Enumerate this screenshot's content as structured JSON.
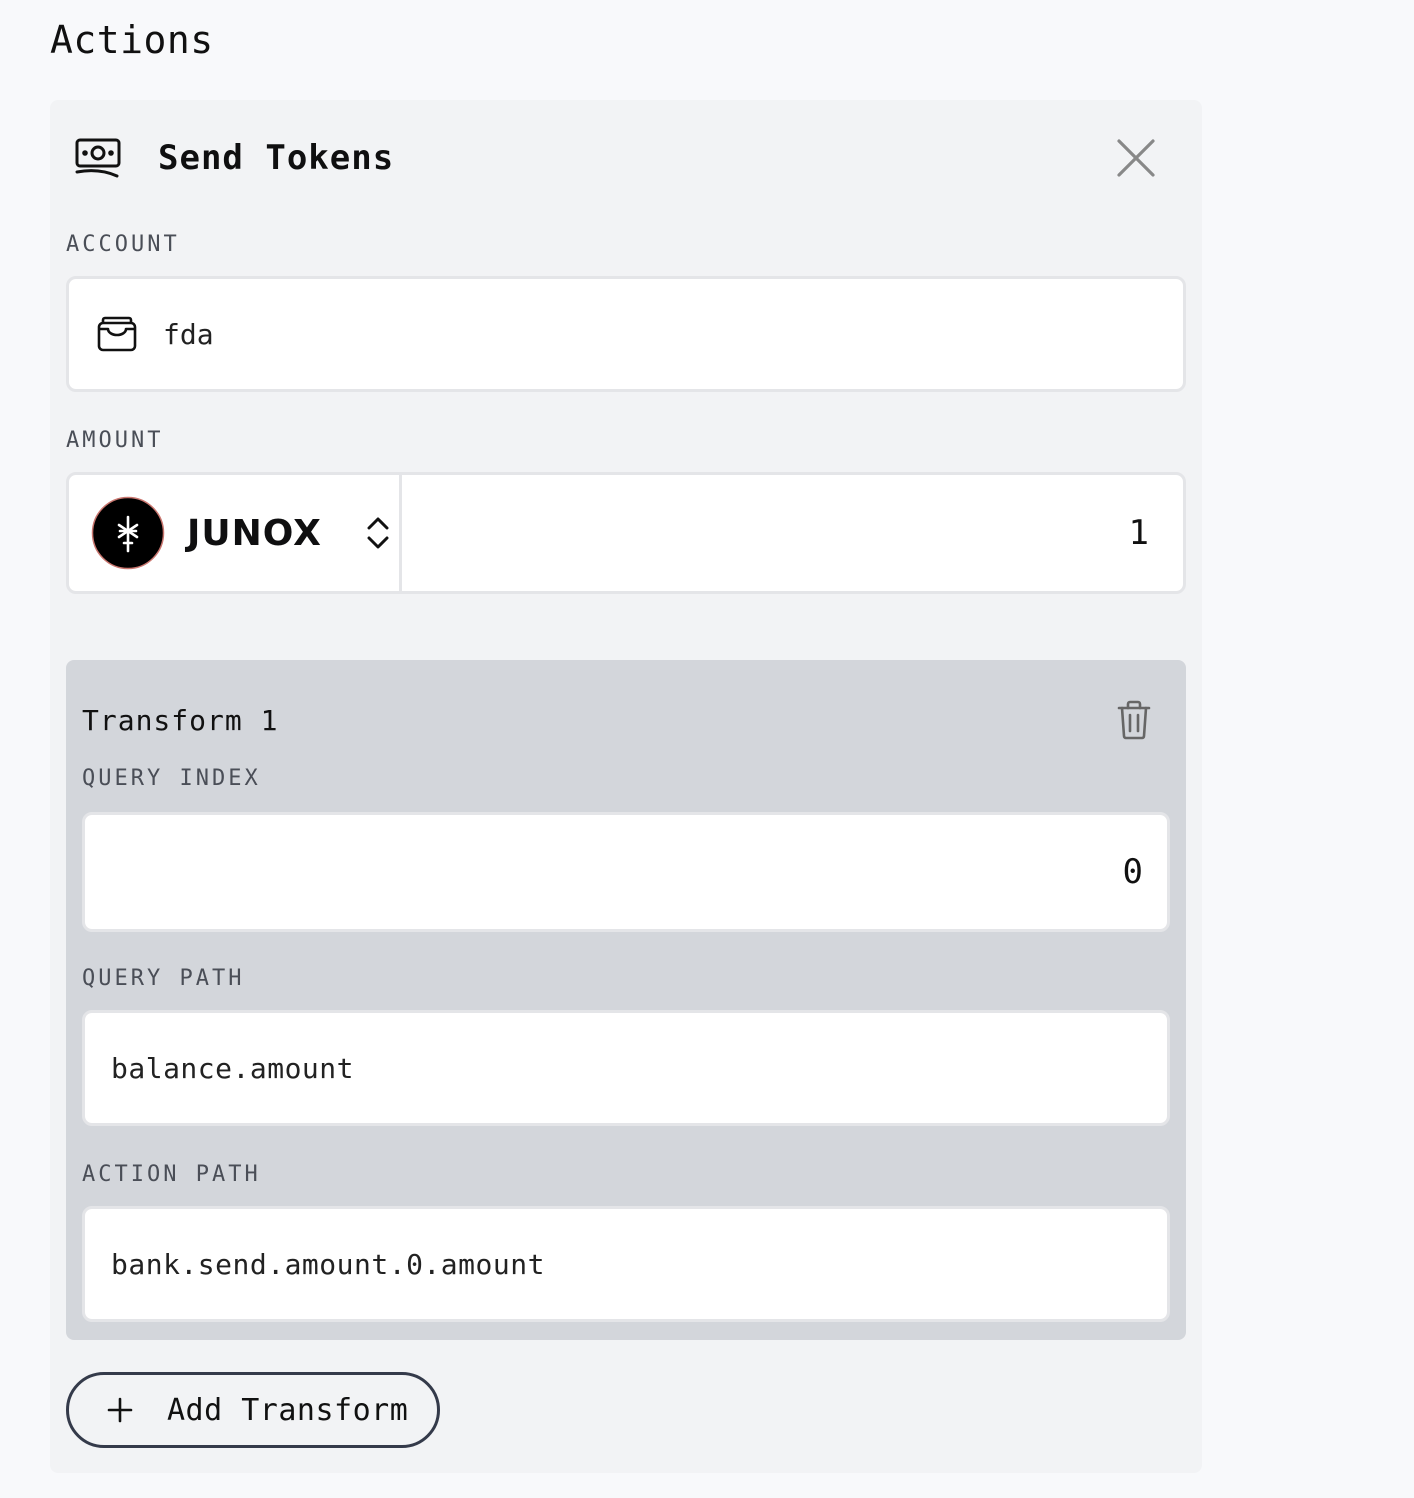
{
  "page": {
    "title": "Actions"
  },
  "action_card": {
    "icon": "money-icon",
    "title": "Send Tokens",
    "close_icon": "close-icon",
    "account": {
      "label": "ACCOUNT",
      "icon": "wallet-icon",
      "value": "fda"
    },
    "amount": {
      "label": "AMOUNT",
      "token": "JUNOX",
      "token_icon": "junox-logo",
      "value": "1"
    },
    "transform": {
      "title": "Transform 1",
      "delete_icon": "trash-icon",
      "query_index": {
        "label": "QUERY INDEX",
        "value": "0"
      },
      "query_path": {
        "label": "QUERY PATH",
        "value": "balance.amount"
      },
      "action_path": {
        "label": "ACTION PATH",
        "value": "bank.send.amount.0.amount"
      }
    },
    "add_transform": {
      "icon": "plus-icon",
      "label": "Add Transform"
    }
  },
  "colors": {
    "page_bg": "#f8f9fb",
    "card_bg": "#f2f3f5",
    "transform_bg": "#d3d6db",
    "token_logo_bg": "#000000",
    "token_logo_ring": "#c9766f"
  }
}
